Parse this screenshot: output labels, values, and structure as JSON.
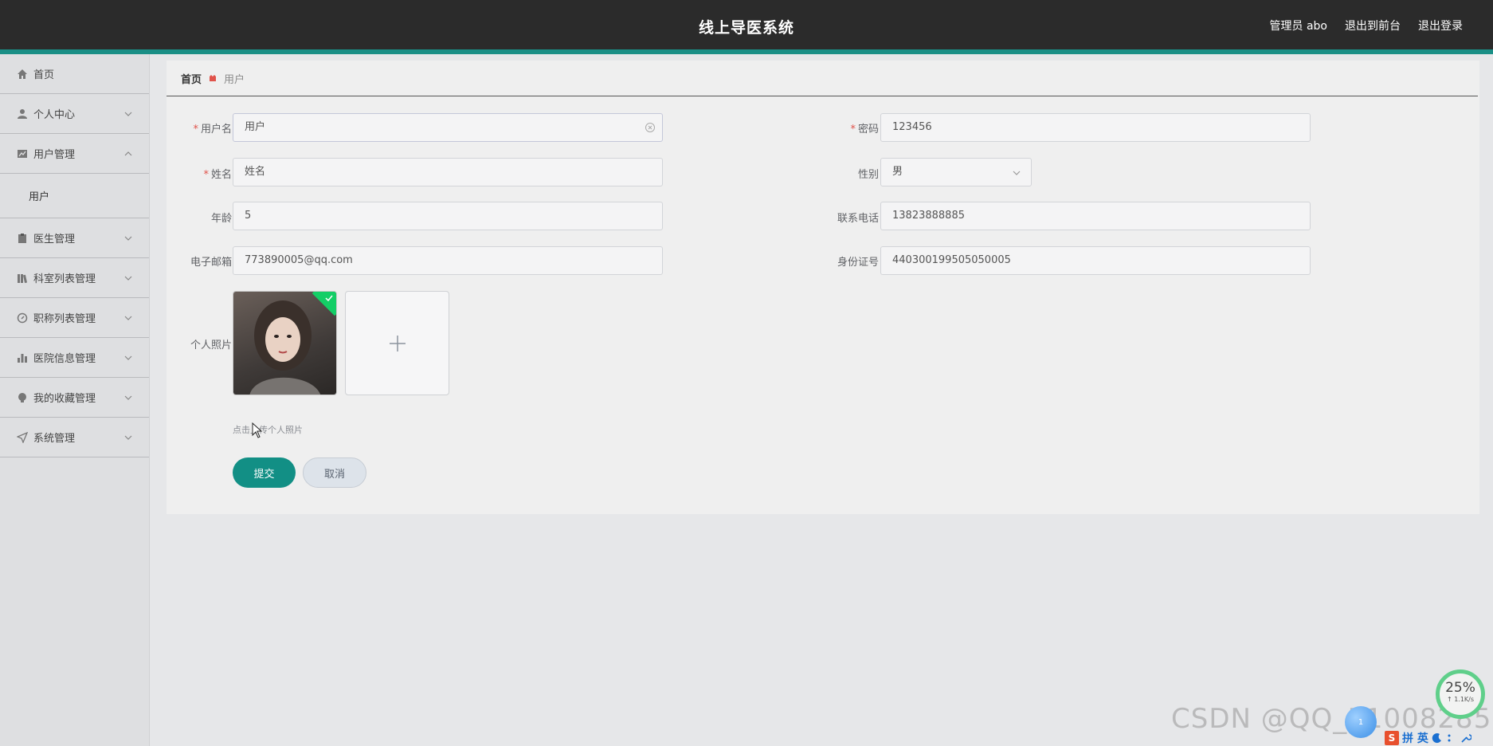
{
  "header": {
    "title": "线上导医系统",
    "links": [
      "管理员 abo",
      "退出到前台",
      "退出登录"
    ]
  },
  "sidebar": {
    "items": [
      {
        "label": "首页",
        "icon": "home-icon"
      },
      {
        "label": "个人中心",
        "icon": "user-icon"
      },
      {
        "label": "用户管理",
        "icon": "chart-icon",
        "expanded": true,
        "sub": [
          "用户"
        ]
      },
      {
        "label": "医生管理",
        "icon": "clipboard-icon"
      },
      {
        "label": "科室列表管理",
        "icon": "library-icon"
      },
      {
        "label": "职称列表管理",
        "icon": "compass-icon"
      },
      {
        "label": "医院信息管理",
        "icon": "bar-chart-icon"
      },
      {
        "label": "我的收藏管理",
        "icon": "bulb-icon"
      },
      {
        "label": "系统管理",
        "icon": "send-icon"
      }
    ]
  },
  "breadcrumb": {
    "home": "首页",
    "current": "用户"
  },
  "form": {
    "username": {
      "label": "用户名",
      "value": "用户"
    },
    "password": {
      "label": "密码",
      "value": "123456"
    },
    "name": {
      "label": "姓名",
      "value": "姓名"
    },
    "gender": {
      "label": "性别",
      "value": "男"
    },
    "age": {
      "label": "年龄",
      "value": "5"
    },
    "phone": {
      "label": "联系电话",
      "value": "13823888885"
    },
    "email": {
      "label": "电子邮箱",
      "value": "773890005@qq.com"
    },
    "id_number": {
      "label": "身份证号",
      "value": "440300199505050005"
    },
    "photo": {
      "label": "个人照片",
      "hint": "点击上传个人照片"
    },
    "submit_label": "提交",
    "cancel_label": "取消"
  },
  "overlay": {
    "watermark": "CSDN @QQ_51008285",
    "speed_percent": "25%",
    "speed_rate": "↑ 1.1K/s",
    "ball_text": "1",
    "ime_logo": "S",
    "ime_text": "拼 英"
  },
  "colors": {
    "accent": "#128f85",
    "header_bg": "#2b2b2b",
    "required": "#e0534b"
  }
}
